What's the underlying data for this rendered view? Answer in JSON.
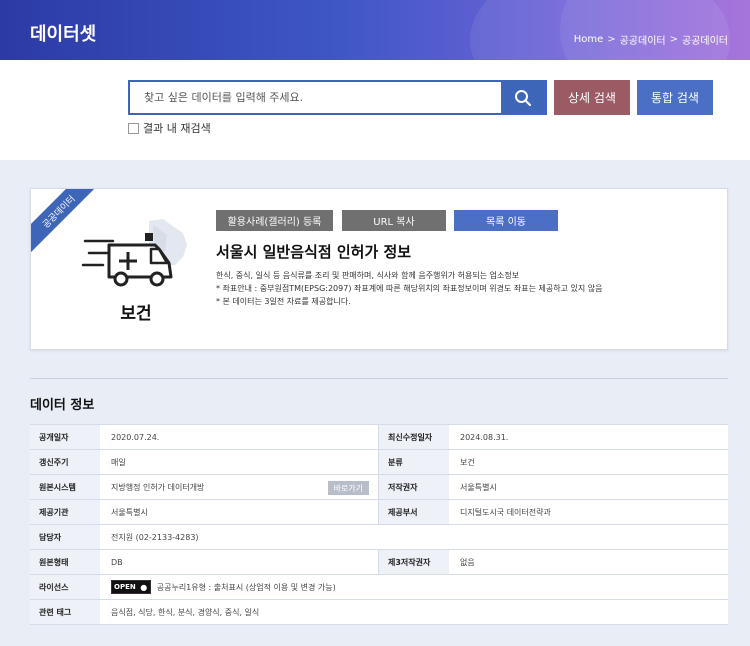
{
  "header": {
    "title": "데이터셋",
    "breadcrumb": [
      "Home",
      "공공데이터",
      "공공데이터"
    ],
    "separator": ">"
  },
  "search": {
    "placeholder": "찾고 싶은 데이터를 입력해 주세요.",
    "detail_label": "상세 검색",
    "total_label": "통합 검색",
    "recheck_label": "결과 내 재검색"
  },
  "dataset": {
    "ribbon": "공공데이터",
    "category": "보건",
    "actions": {
      "register": "활용사례(갤러리) 등록",
      "copy_url": "URL 복사",
      "go_list": "목록 이동"
    },
    "title": "서울시 일반음식점 인허가 정보",
    "desc": [
      "한식, 중식, 일식 등 음식류를 조리 및 판매하며, 식사와 함께 음주행위가 허용되는 업소정보",
      "* 좌표안내 : 중부원점TM(EPSG:2097) 좌표계에 따른 해당위치의 좌표정보이며 위경도 좌표는 제공하고 있지 않음",
      "* 본 데이터는 3일전 자료를 제공합니다."
    ]
  },
  "info": {
    "section_title": "데이터 정보",
    "open_date_label": "공개일자",
    "open_date": "2020.07.24.",
    "modified_label": "최신수정일자",
    "modified": "2024.08.31.",
    "cycle_label": "갱신주기",
    "cycle": "매일",
    "class_label": "분류",
    "class": "보건",
    "source_label": "원본시스템",
    "source": "지방행정 인허가 데이터개방",
    "source_btn": "바로가기",
    "author_label": "저작권자",
    "author": "서울특별시",
    "provider_label": "제공기관",
    "provider": "서울특별시",
    "dept_label": "제공부서",
    "dept": "디지털도시국 데이터전략과",
    "manager_label": "담당자",
    "manager": "전지원 (02-2133-4283)",
    "format_label": "원본형태",
    "format": "DB",
    "third_label": "제3저작권자",
    "third": "없음",
    "license_label": "라이선스",
    "license_badge": "OPEN",
    "license": "공공누리1유형 : 출처표시 (상업적 이용 및 변경 가능)",
    "tags_label": "관련 태그",
    "tags": "음식점, 식당, 한식, 분식, 경양식, 중식, 일식"
  },
  "colors": {
    "primary": "#3e66b8",
    "detail_button": "#9a5b64",
    "gray_button": "#707070",
    "background": "#e8edf6"
  }
}
